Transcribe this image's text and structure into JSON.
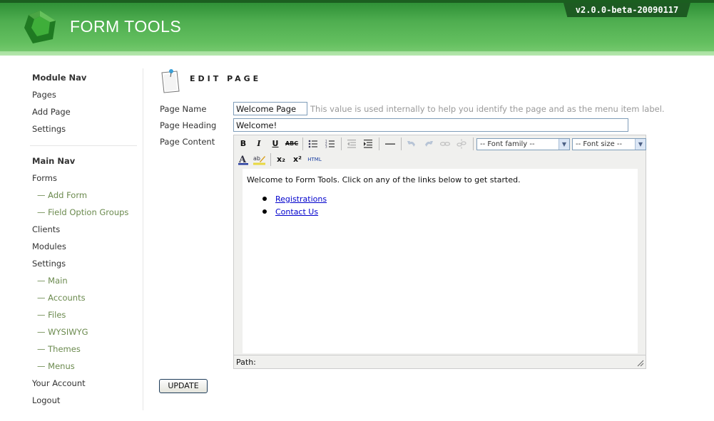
{
  "header": {
    "brand": "FORM TOOLS",
    "version": "v2.0.0-beta-20090117"
  },
  "sidebar": {
    "module_nav_heading": "Module Nav",
    "module_items": [
      "Pages",
      "Add Page",
      "Settings"
    ],
    "main_nav_heading": "Main Nav",
    "main_items": {
      "forms": "Forms",
      "add_form": "— Add Form",
      "field_option_groups": "— Field Option Groups",
      "clients": "Clients",
      "modules": "Modules",
      "settings": "Settings",
      "settings_main": "— Main",
      "settings_accounts": "— Accounts",
      "settings_files": "— Files",
      "settings_wysiwyg": "— WYSIWYG",
      "settings_themes": "— Themes",
      "settings_menus": "— Menus",
      "your_account": "Your Account",
      "logout": "Logout"
    }
  },
  "main": {
    "title": "EDIT PAGE",
    "page_name_label": "Page Name",
    "page_name_value": "Welcome Page",
    "page_name_hint": "This value is used internally to help you identify the page and as the menu item label.",
    "page_heading_label": "Page Heading",
    "page_heading_value": "Welcome!",
    "page_content_label": "Page Content",
    "update_button": "UPDATE"
  },
  "editor": {
    "toolbar": {
      "bold": "B",
      "italic": "I",
      "underline": "U",
      "strikethrough": "ABC",
      "font_family": "-- Font family --",
      "font_size": "-- Font size --",
      "subscript": "x₂",
      "superscript": "x²",
      "html": "HTML"
    },
    "content": {
      "intro": "Welcome to Form Tools. Click on any of the links below to get started.",
      "links": [
        "Registrations",
        "Contact Us"
      ]
    },
    "status_path": "Path:"
  },
  "colors": {
    "header_green": "#4fae50",
    "version_bg": "#1d5b22",
    "subnav_text": "#6b8a4e",
    "link": "#0000cc"
  }
}
